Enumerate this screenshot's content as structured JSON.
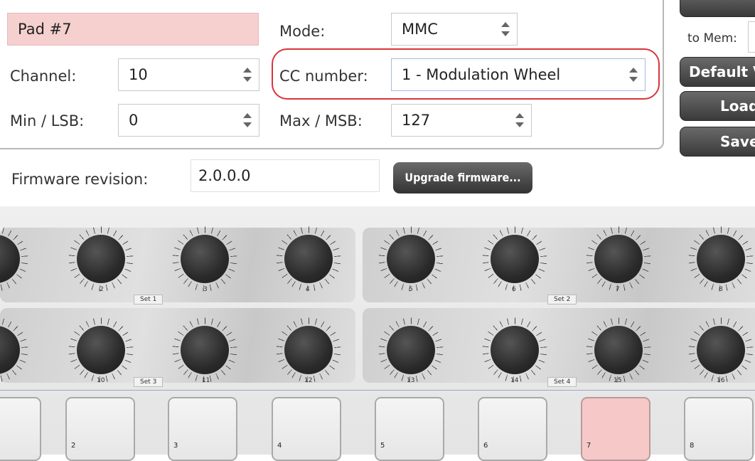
{
  "pad_settings": {
    "name_value": "Pad #7",
    "channel_label": "Channel:",
    "channel_value": "10",
    "min_label": "Min / LSB:",
    "min_value": "0",
    "mode_label": "Mode:",
    "mode_value": "MMC",
    "cc_label": "CC number:",
    "cc_value": "1 - Modulation Wheel",
    "max_label": "Max / MSB:",
    "max_value": "127"
  },
  "side_panel": {
    "to_mem_label": "to Mem:",
    "default_label": "Default V",
    "load_label": "Load",
    "save_label": "Save"
  },
  "firmware": {
    "label": "Firmware revision:",
    "value": "2.0.0.0",
    "upgrade_label": "Upgrade firmware..."
  },
  "controller": {
    "knob_numbers_top": [
      "2",
      "3",
      "4",
      "5",
      "6",
      "7",
      "8"
    ],
    "knob_numbers_bottom": [
      "10",
      "11",
      "12",
      "13",
      "14",
      "15",
      "16"
    ],
    "set_labels": [
      "Set 1",
      "Set 2",
      "Set 3",
      "Set 4"
    ],
    "pad_numbers": [
      "2",
      "3",
      "4",
      "5",
      "6",
      "7",
      "8"
    ],
    "selected_pad": "7",
    "highlight_color": "#f6c8c8"
  },
  "annotation_color": "#d8353a"
}
